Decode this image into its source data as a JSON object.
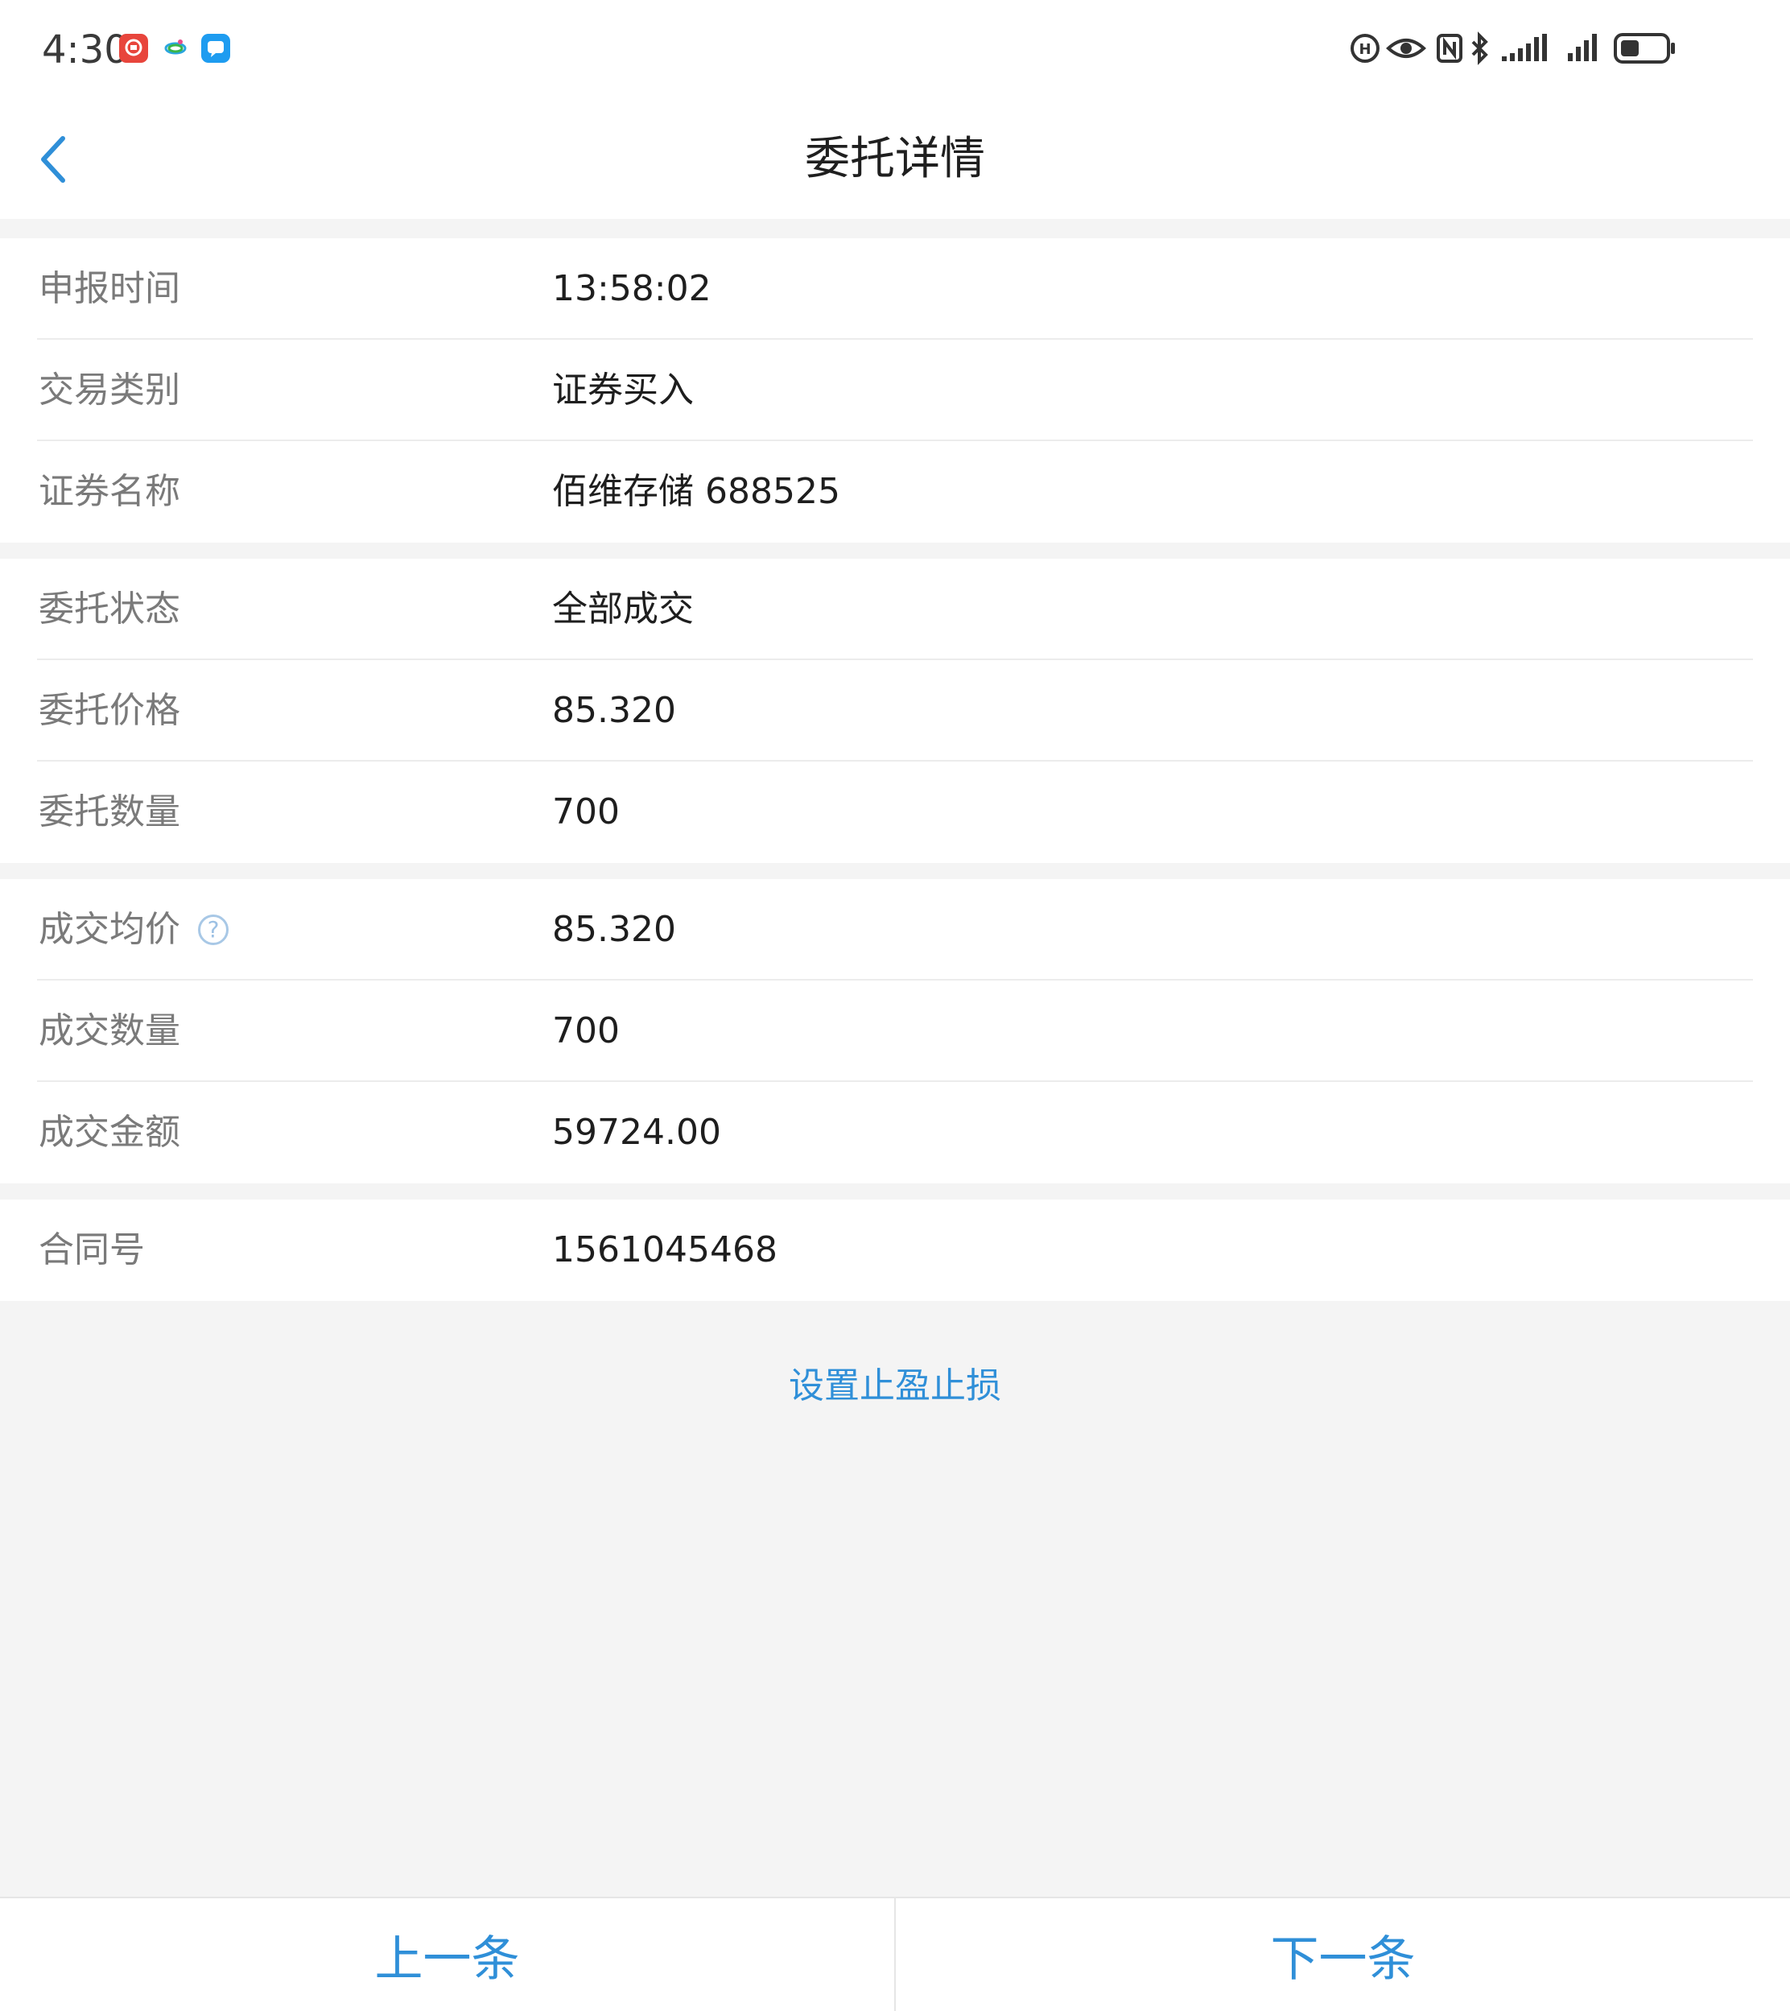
{
  "status_bar": {
    "time": "4:30",
    "app_icons": [
      "red-app-icon",
      "colorful-swirl-icon",
      "blue-message-icon"
    ],
    "right_icons": [
      "hd-icon",
      "eye-icon",
      "nfc-icon",
      "bluetooth-icon",
      "signal-icon",
      "signal-icon",
      "battery-icon"
    ]
  },
  "navbar": {
    "title": "委托详情",
    "back_icon": "chevron-left-icon"
  },
  "groups": [
    {
      "rows": [
        {
          "label": "申报时间",
          "value": "13:58:02"
        },
        {
          "label": "交易类别",
          "value": "证券买入"
        },
        {
          "label": "证券名称",
          "value": "佰维存储 688525"
        }
      ]
    },
    {
      "rows": [
        {
          "label": "委托状态",
          "value": "全部成交"
        },
        {
          "label": "委托价格",
          "value": "85.320"
        },
        {
          "label": "委托数量",
          "value": "700"
        }
      ]
    },
    {
      "rows": [
        {
          "label": "成交均价",
          "value": "85.320",
          "help": "?"
        },
        {
          "label": "成交数量",
          "value": "700"
        },
        {
          "label": "成交金额",
          "value": "59724.00"
        }
      ]
    },
    {
      "rows": [
        {
          "label": "合同号",
          "value": "1561045468"
        }
      ]
    }
  ],
  "action_link": "设置止盈止损",
  "bottom_bar": {
    "prev": "上一条",
    "next": "下一条"
  },
  "colors": {
    "accent": "#2f8fd8",
    "label": "#7a7a7a",
    "value": "#1e1e1e",
    "background": "#f4f4f4"
  }
}
